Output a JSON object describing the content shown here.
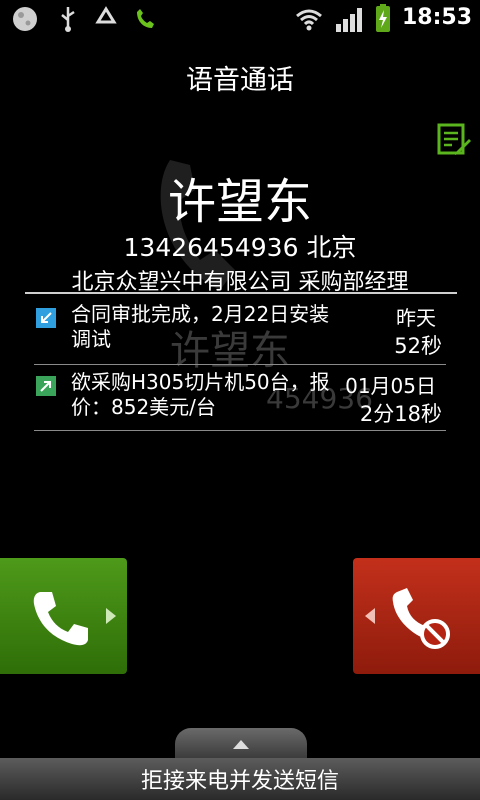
{
  "status_bar": {
    "time": "18:53",
    "icons": [
      "moon-weather-icon",
      "usb-icon",
      "recycle-icon",
      "phone-call-icon",
      "wifi-icon",
      "signal-icon",
      "battery-charging-icon"
    ]
  },
  "call": {
    "title": "语音通话",
    "watermark_name": "许望东",
    "watermark_number": "454936"
  },
  "contact": {
    "name": "许望东",
    "number_location": "13426454936  北京",
    "company_title": "北京众望兴中有限公司 采购部经理"
  },
  "history": [
    {
      "direction": "incoming",
      "text": "合同审批完成，2月22日安装调试",
      "date": "昨天",
      "duration": "52秒",
      "color": "#2f9fe0"
    },
    {
      "direction": "outgoing",
      "text": "欲采购H305切片机50台，报价：852美元/台",
      "date": "01月05日",
      "duration": "2分18秒",
      "color": "#3aa45a"
    }
  ],
  "actions": {
    "answer_color": "#4e9a1a",
    "decline_color": "#c3301b",
    "reject_with_sms": "拒接来电并发送短信"
  }
}
